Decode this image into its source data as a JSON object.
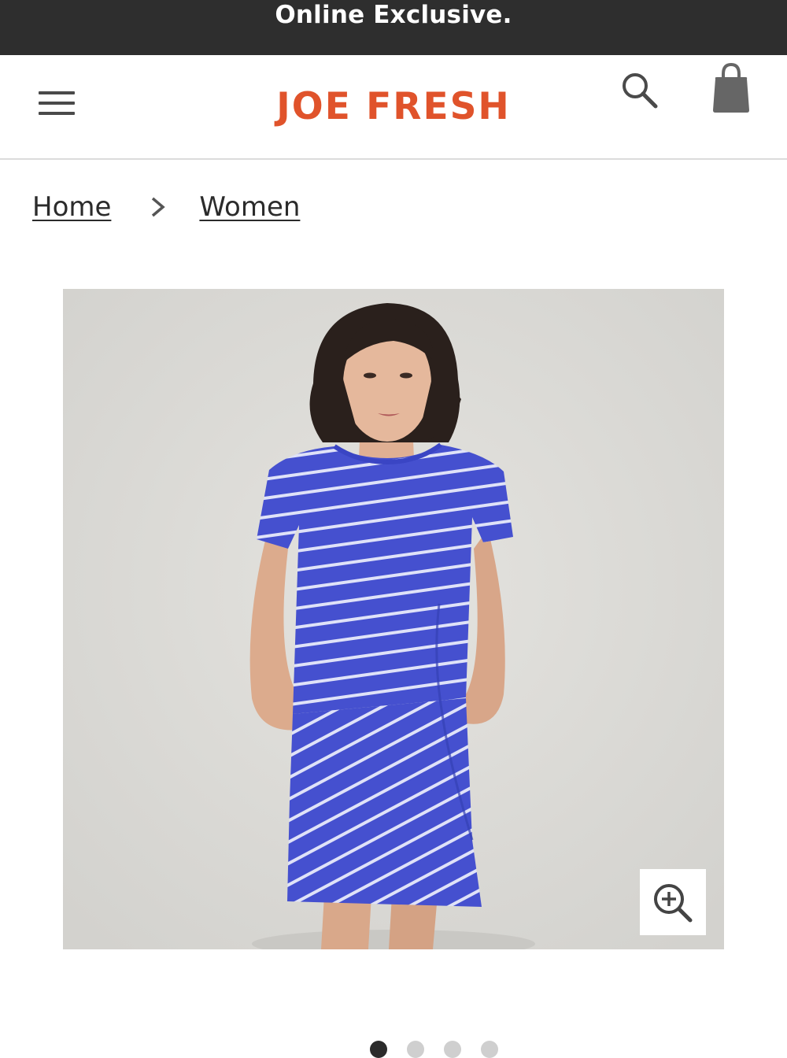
{
  "promo": {
    "text": "Online Exclusive."
  },
  "header": {
    "menu_icon": "hamburger-menu-icon",
    "logo": "JOE FRESH",
    "search_icon": "search-icon",
    "bag_icon": "shopping-bag-icon"
  },
  "breadcrumb": {
    "items": [
      "Home",
      "Women"
    ],
    "separator_icon": "chevron-right-icon"
  },
  "product": {
    "image_subject": "model-in-blue-white-striped-t-shirt-dress",
    "zoom_icon": "zoom-in-icon"
  },
  "carousel": {
    "dot_count": 4,
    "active_index": 0
  },
  "colors": {
    "brand": "#e0532b",
    "promo_bg": "#2e2e2e",
    "image_bg": "#dcdbd7",
    "dress_blue": "#4550cf",
    "text": "#2b2b2b"
  }
}
